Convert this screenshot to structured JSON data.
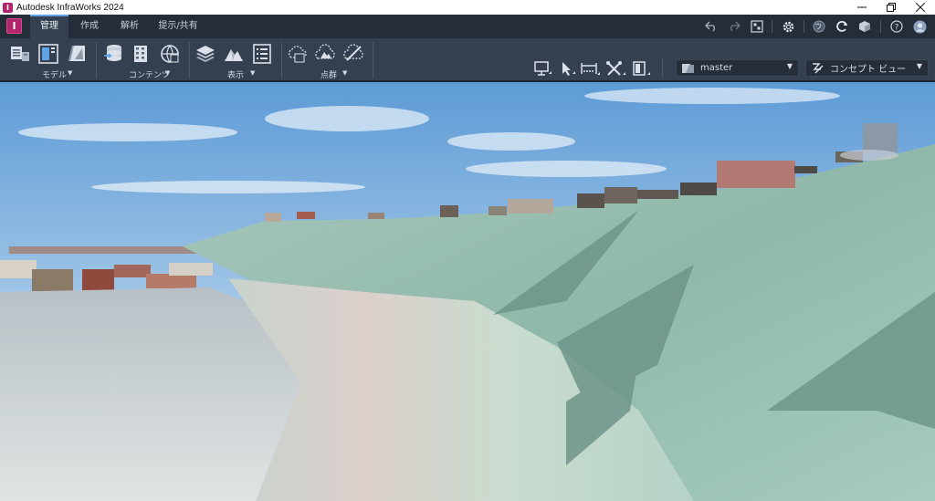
{
  "titlebar": {
    "app_logo": "I",
    "title": "Autodesk InfraWorks 2024",
    "minimize_icon": "minimize-icon",
    "restore_icon": "restore-icon",
    "close_icon": "close-icon"
  },
  "menubar": {
    "app_button": "I",
    "tabs": [
      {
        "label": "管理",
        "active": true
      },
      {
        "label": "作成",
        "active": false
      },
      {
        "label": "解析",
        "active": false
      },
      {
        "label": "提示/共有",
        "active": false
      }
    ],
    "quick_access": [
      "undo-icon",
      "redo-icon",
      "model-explorer-icon",
      "settings-icon",
      "globe-icon",
      "sync-icon",
      "cloud-icon",
      "help-icon",
      "user-avatar-icon"
    ]
  },
  "ribbon": {
    "groups": [
      {
        "label": "モデル",
        "icons": [
          "model-properties-icon",
          "model-panel-icon",
          "model-book-icon"
        ]
      },
      {
        "label": "コンテンツ",
        "icons": [
          "data-sources-icon",
          "building-icon",
          "styles-icon"
        ]
      },
      {
        "label": "表示",
        "icons": [
          "surface-layers-icon",
          "terrain-icon",
          "list-icon"
        ]
      },
      {
        "label": "点群",
        "icons": [
          "point-cloud-icon",
          "point-cloud-terrain-icon",
          "point-cloud-edit-icon"
        ]
      }
    ],
    "tools": [
      "presentation-icon",
      "select-icon",
      "measure-icon",
      "clip-icon",
      "view-icon"
    ],
    "proposal_dropdown": {
      "value": "master"
    },
    "visual_style_dropdown": {
      "value": "コンセプト ビュー"
    }
  },
  "colors": {
    "accent": "#5fa3e6",
    "brand": "#b3246e",
    "ribbon_bg": "#34404f",
    "menubar_bg": "#252d39"
  },
  "viewport": {
    "scene": "3d-terrain-with-buildings"
  }
}
